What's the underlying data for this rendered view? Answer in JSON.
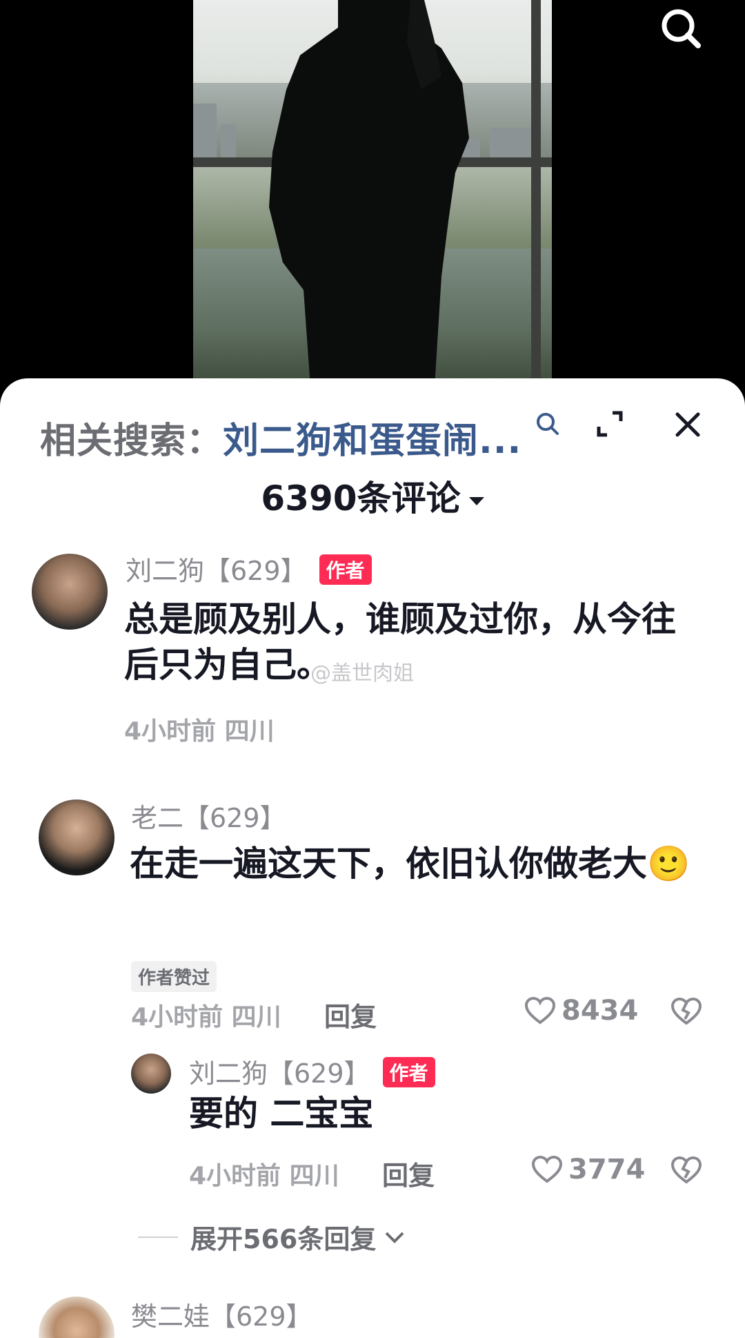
{
  "video": {
    "search_icon": "search-icon"
  },
  "sheet": {
    "related_search_label": "相关搜索：",
    "related_search_query": "刘二狗和蛋蛋闹...",
    "comment_count_title": "6390条评论"
  },
  "comments": [
    {
      "username": "刘二狗【629】",
      "badge": "作者",
      "text": "总是顾及别人，谁顾及过你，从今往后只为自己。",
      "meta": "4小时前 四川"
    },
    {
      "username": "老二【629】",
      "text": "在走一遍这天下，依旧认你做老大",
      "emoji": "🙂",
      "liked_badge": "作者赞过",
      "meta": "4小时前 四川",
      "reply_label": "回复",
      "likes": "8434",
      "reply": {
        "username": "刘二狗【629】",
        "badge": "作者",
        "text": "要的 二宝宝",
        "meta": "4小时前 四川",
        "reply_label": "回复",
        "likes": "3774"
      },
      "expand_label": "展开566条回复"
    },
    {
      "username": "樊二娃【629】"
    }
  ],
  "watermark": "@盖世肉姐",
  "colors": {
    "author_badge": "#fe2c55",
    "link": "#3b5a8c",
    "text_primary": "#161823",
    "text_secondary": "#8a8b91"
  }
}
